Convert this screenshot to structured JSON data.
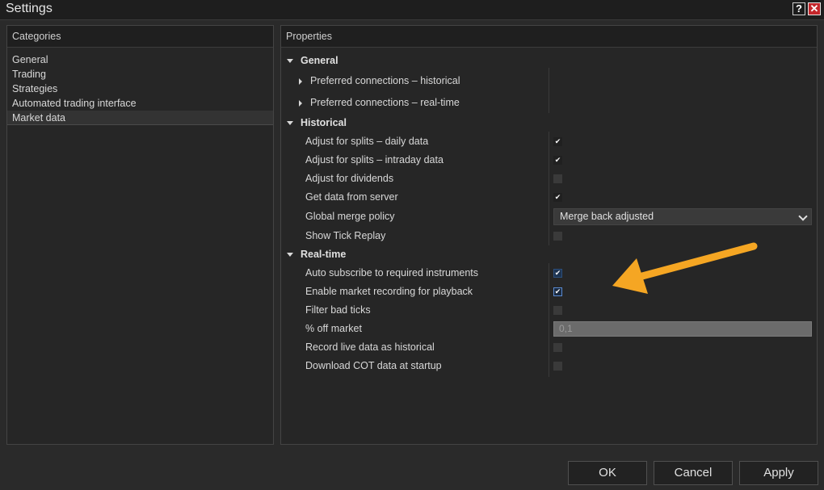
{
  "window": {
    "title": "Settings",
    "help_label": "?",
    "close_label": "✕"
  },
  "categories": {
    "header": "Categories",
    "items": [
      {
        "label": "General"
      },
      {
        "label": "Trading"
      },
      {
        "label": "Strategies"
      },
      {
        "label": "Automated trading interface"
      },
      {
        "label": "Market data",
        "selected": true
      }
    ]
  },
  "properties": {
    "header": "Properties",
    "general": {
      "label": "General",
      "items": [
        {
          "label": "Preferred connections – historical"
        },
        {
          "label": "Preferred connections – real-time"
        }
      ]
    },
    "historical": {
      "label": "Historical",
      "items": [
        {
          "label": "Adjust for splits – daily data",
          "checked": true
        },
        {
          "label": "Adjust for splits – intraday data",
          "checked": true
        },
        {
          "label": "Adjust for dividends",
          "checked": false
        },
        {
          "label": "Get data from server",
          "checked": true
        },
        {
          "label": "Global merge policy",
          "value": "Merge back adjusted"
        },
        {
          "label": "Show Tick Replay",
          "checked": false
        }
      ]
    },
    "realtime": {
      "label": "Real-time",
      "items": [
        {
          "label": "Auto subscribe to required instruments",
          "checked": true
        },
        {
          "label": "Enable market recording for playback",
          "checked": true
        },
        {
          "label": "Filter bad ticks",
          "checked": false
        },
        {
          "label": "% off market",
          "value": "0,1"
        },
        {
          "label": "Record live data as historical",
          "checked": false
        },
        {
          "label": "Download COT data at startup",
          "checked": false
        }
      ]
    }
  },
  "check_glyph": "✔",
  "footer": {
    "ok_label": "OK",
    "cancel_label": "Cancel",
    "apply_label": "Apply"
  },
  "colors": {
    "background": "#2a2a2a",
    "accent_arrow": "#f5a623",
    "close_button": "#c4262b"
  }
}
